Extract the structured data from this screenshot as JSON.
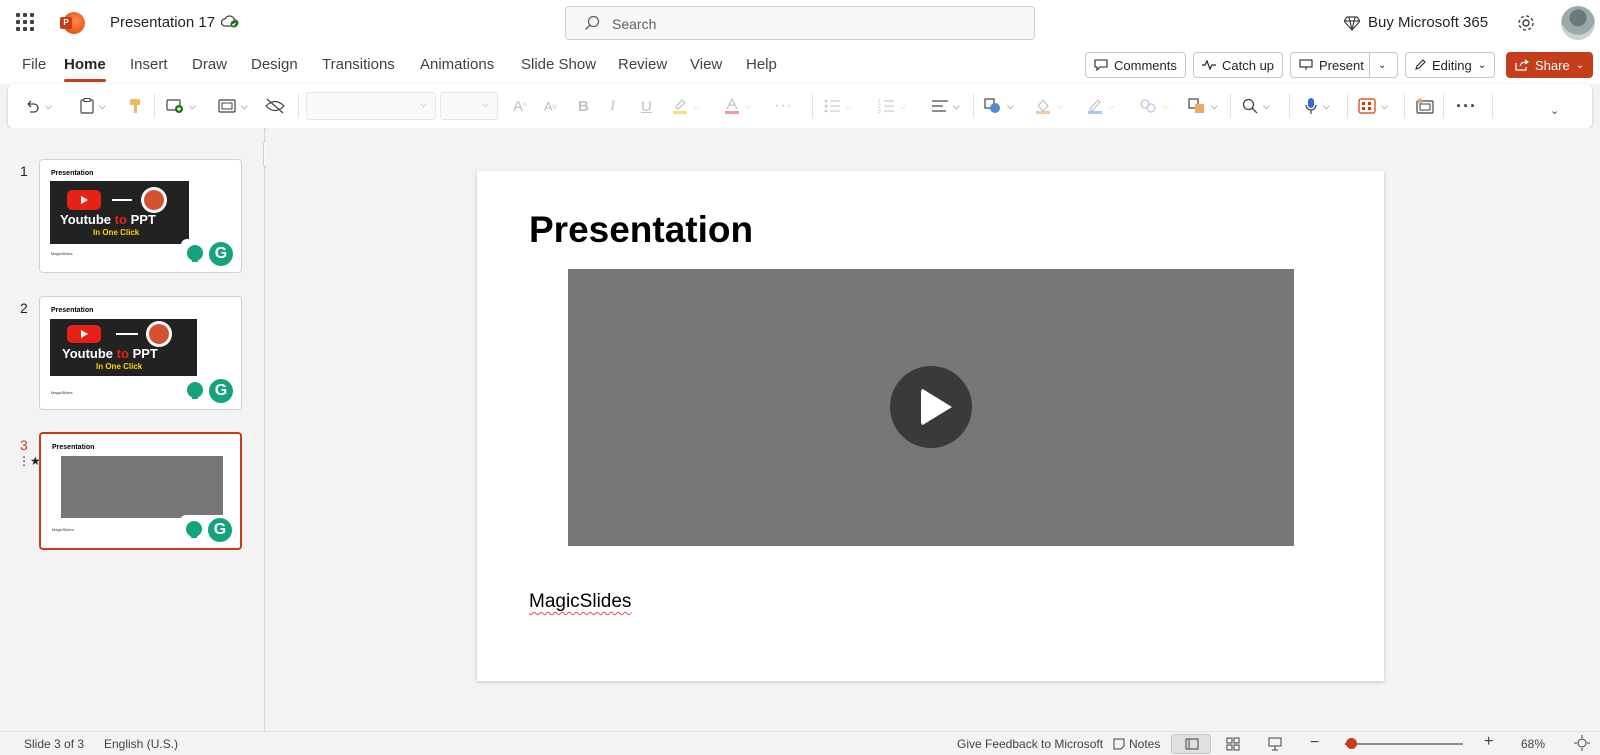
{
  "titlebar": {
    "doc_title": "Presentation 17",
    "search_placeholder": "Search",
    "buy_label": "Buy Microsoft 365"
  },
  "menu": {
    "tabs": [
      "File",
      "Home",
      "Insert",
      "Draw",
      "Design",
      "Transitions",
      "Animations",
      "Slide Show",
      "Review",
      "View",
      "Help"
    ],
    "active_tab": "Home",
    "comments_label": "Comments",
    "catchup_label": "Catch up",
    "present_label": "Present",
    "editing_label": "Editing",
    "share_label": "Share"
  },
  "thumbnails": [
    {
      "number": "1",
      "title": "Presentation",
      "line1": "Youtube",
      "line1_accent": "to",
      "line1_end": "PPT",
      "line2": "In One Click",
      "footer": "MagicSlides"
    },
    {
      "number": "2",
      "title": "Presentation",
      "line1": "Youtube",
      "line1_accent": "to",
      "line1_end": "PPT",
      "line2": "In One Click",
      "footer": "MagicSlides"
    },
    {
      "number": "3",
      "title": "Presentation",
      "footer": "MagicSlides"
    }
  ],
  "active_slide_index": 3,
  "slide": {
    "title": "Presentation",
    "footer": "MagicSlides"
  },
  "statusbar": {
    "slide_info": "Slide 3 of 3",
    "language": "English (U.S.)",
    "feedback": "Give Feedback to Microsoft",
    "notes": "Notes",
    "zoom": "68%",
    "zoom_level": 0.68
  },
  "colors": {
    "accent": "#c43e1c",
    "video_placeholder": "#777777",
    "grammarly": "#15a37e"
  }
}
